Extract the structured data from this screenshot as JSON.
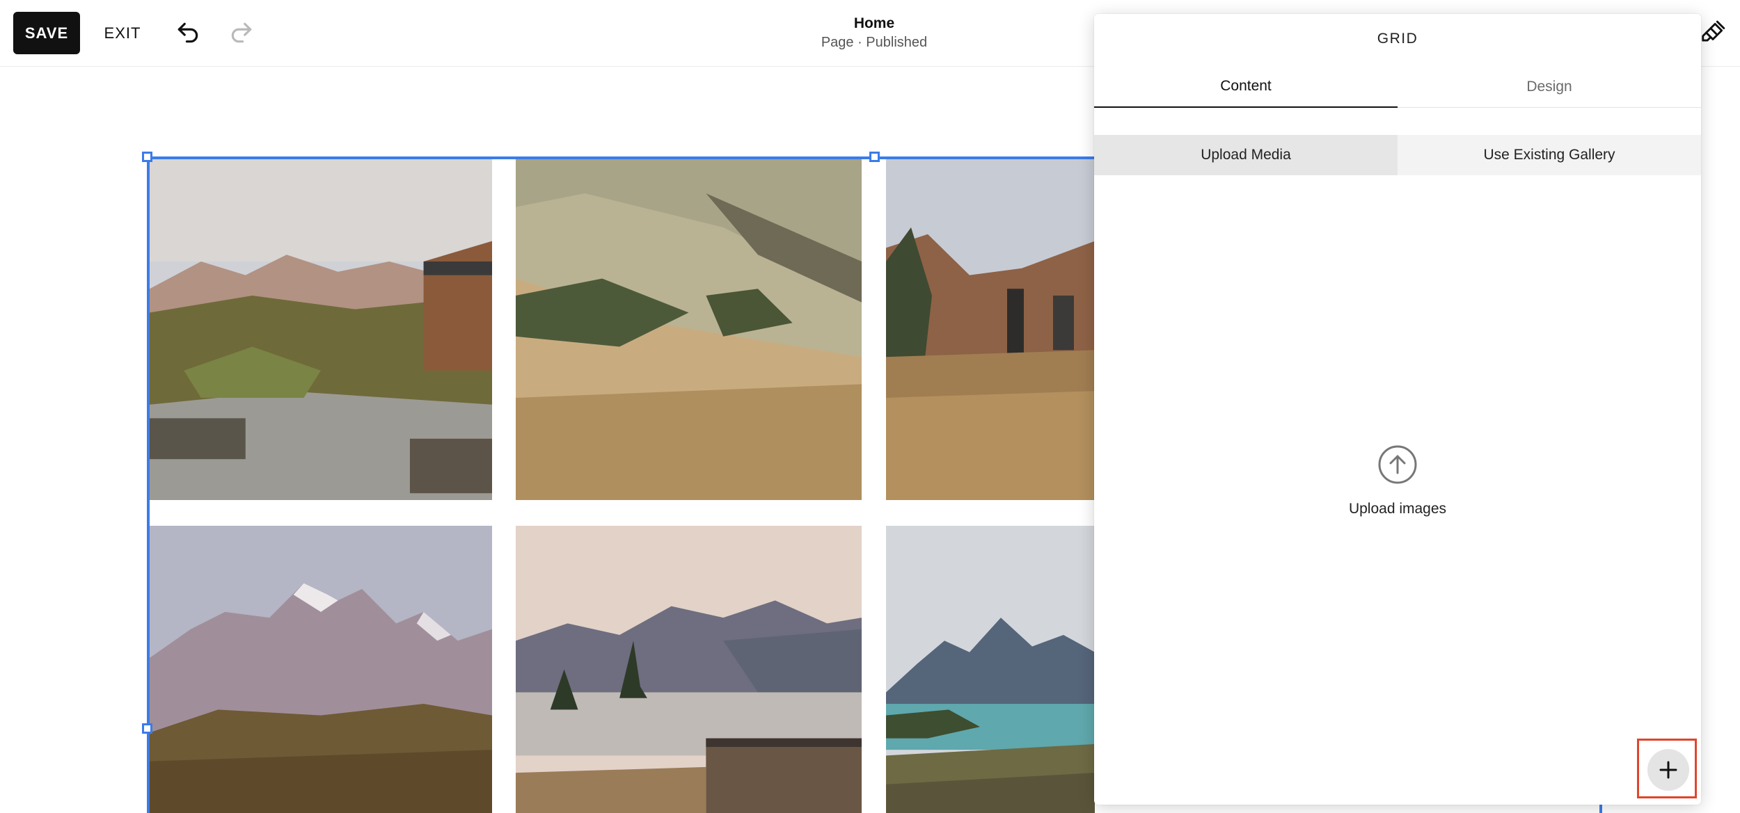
{
  "toolbar": {
    "save_label": "SAVE",
    "exit_label": "EXIT",
    "undo_icon": "undo-icon",
    "redo_icon": "redo-icon",
    "style_icon": "paintbrush-icon"
  },
  "page": {
    "title": "Home",
    "status": "Page · Published"
  },
  "gallery": {
    "selection_color": "#3b7ce8",
    "images": [
      {
        "name": "photo-lodge-mountains",
        "subject": "wooden lodge with stone steps and mountains"
      },
      {
        "name": "photo-grassy-hillside",
        "subject": "golden grass hillside"
      },
      {
        "name": "photo-cabin-meadow",
        "subject": "wooden cabin in tall grass"
      },
      {
        "name": "photo-snowy-peaks",
        "subject": "snow capped mountain range"
      },
      {
        "name": "photo-lake-sunset",
        "subject": "lake with mountains and cabin"
      },
      {
        "name": "photo-turquoise-lake",
        "subject": "turquoise lake with mountains"
      }
    ]
  },
  "panel": {
    "title": "GRID",
    "tabs": [
      {
        "label": "Content",
        "active": true
      },
      {
        "label": "Design",
        "active": false
      }
    ],
    "source_options": [
      {
        "label": "Upload Media",
        "selected": true
      },
      {
        "label": "Use Existing Gallery",
        "selected": false
      }
    ],
    "upload": {
      "icon": "upload-arrow-icon",
      "label": "Upload images"
    },
    "add_button_icon": "plus-icon",
    "highlight_color": "#e0452b"
  }
}
